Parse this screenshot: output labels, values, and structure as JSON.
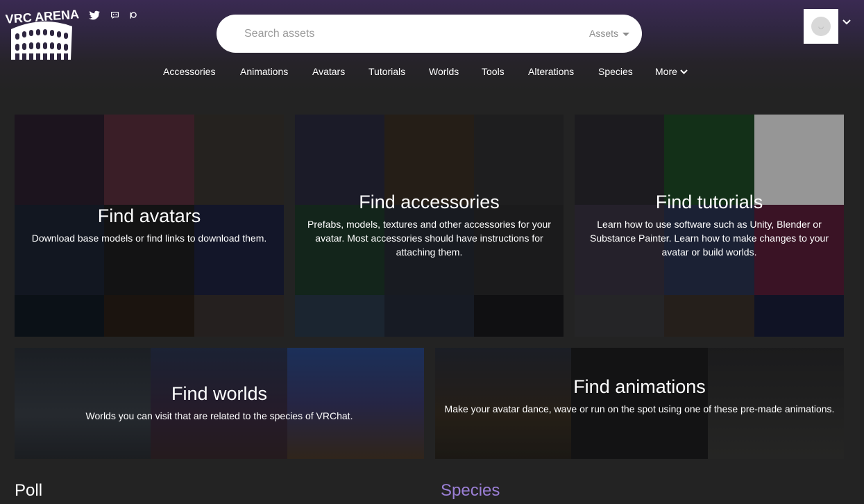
{
  "brand": {
    "logo_text": "VRC ARENA"
  },
  "social": {
    "icons": [
      "twitter-icon",
      "discord-icon",
      "patreon-icon"
    ]
  },
  "search": {
    "placeholder": "Search assets",
    "scope": "Assets"
  },
  "nav": {
    "items": [
      "Accessories",
      "Animations",
      "Avatars",
      "Tutorials",
      "Worlds",
      "Tools",
      "Alterations",
      "Species"
    ],
    "more_label": "More"
  },
  "cards": {
    "avatars": {
      "title": "Find avatars",
      "description": "Download base models or find links to download them."
    },
    "accessories": {
      "title": "Find accessories",
      "description": "Prefabs, models, textures and other accessories for your avatar. Most accessories should have instructions for attaching them."
    },
    "tutorials": {
      "title": "Find tutorials",
      "description": "Learn how to use software such as Unity, Blender or Substance Painter. Learn how to make changes to your avatar or build worlds."
    },
    "worlds": {
      "title": "Find worlds",
      "description": "Worlds you can visit that are related to the species of VRChat."
    },
    "animations": {
      "title": "Find animations",
      "description": "Make your avatar dance, wave or run on the spot using one of these pre-made animations."
    }
  },
  "sections": {
    "poll": "Poll",
    "species": "Species"
  },
  "colors": {
    "accent": "#9b7fd6",
    "header_top": "#3a2a52",
    "background": "#232323"
  }
}
